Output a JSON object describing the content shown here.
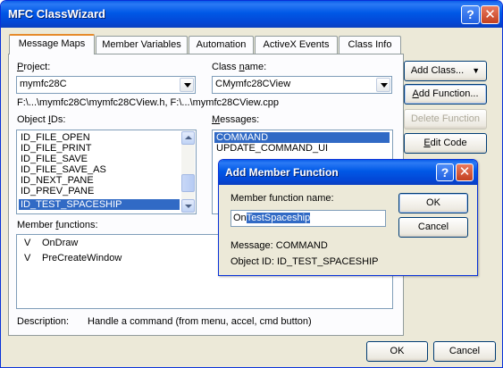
{
  "window": {
    "title": "MFC ClassWizard",
    "help_glyph": "?",
    "close_glyph": "✕"
  },
  "tabs": [
    {
      "label": "Message Maps",
      "active": true
    },
    {
      "label": "Member Variables",
      "active": false
    },
    {
      "label": "Automation",
      "active": false
    },
    {
      "label": "ActiveX Events",
      "active": false
    },
    {
      "label": "Class Info",
      "active": false
    }
  ],
  "project": {
    "label_pre": "",
    "label_u": "P",
    "label_post": "roject:",
    "value": "mymfc28C"
  },
  "class_name": {
    "label_pre": "Class ",
    "label_u": "n",
    "label_post": "ame:",
    "value": "CMymfc28CView"
  },
  "path_text": "F:\\...\\mymfc28C\\mymfc28CView.h, F:\\...\\mymfc28CView.cpp",
  "object_ids": {
    "label_pre": "Object ",
    "label_u": "I",
    "label_post": "Ds:",
    "items": [
      "ID_FILE_OPEN",
      "ID_FILE_PRINT",
      "ID_FILE_SAVE",
      "ID_FILE_SAVE_AS",
      "ID_NEXT_PANE",
      "ID_PREV_PANE",
      "ID_TEST_SPACESHIP"
    ],
    "selected_index": 6
  },
  "messages": {
    "label_pre": "",
    "label_u": "M",
    "label_post": "essages:",
    "items": [
      "COMMAND",
      "UPDATE_COMMAND_UI"
    ],
    "selected_index": 0
  },
  "member_functions": {
    "label_pre": "Member ",
    "label_u": "f",
    "label_post": "unctions:",
    "rows": [
      {
        "flag": "V",
        "name": "OnDraw"
      },
      {
        "flag": "V",
        "name": "PreCreateWindow"
      }
    ]
  },
  "description": {
    "label": "Description:",
    "text": "Handle a command (from menu, accel, cmd button)"
  },
  "side_buttons": {
    "add_class": "Add Class...",
    "add_class_arrow": "▼",
    "add_function_pre": "",
    "add_function_u": "A",
    "add_function_post": "dd Function...",
    "delete_function": "Delete Function",
    "edit_code_pre": "",
    "edit_code_u": "E",
    "edit_code_post": "dit Code"
  },
  "bottom_buttons": {
    "ok": "OK",
    "cancel": "Cancel"
  },
  "dialog": {
    "title": "Add Member Function",
    "field_label": "Member function name:",
    "name_prefix": "On",
    "name_selected": "TestSpaceship",
    "ok": "OK",
    "cancel": "Cancel",
    "message_line": "Message: COMMAND",
    "object_id_line": "Object ID: ID_TEST_SPACESHIP"
  },
  "colors": {
    "selection": "#316ac5",
    "title_bar": "#0058e6",
    "dialog_face": "#ece9d8"
  }
}
